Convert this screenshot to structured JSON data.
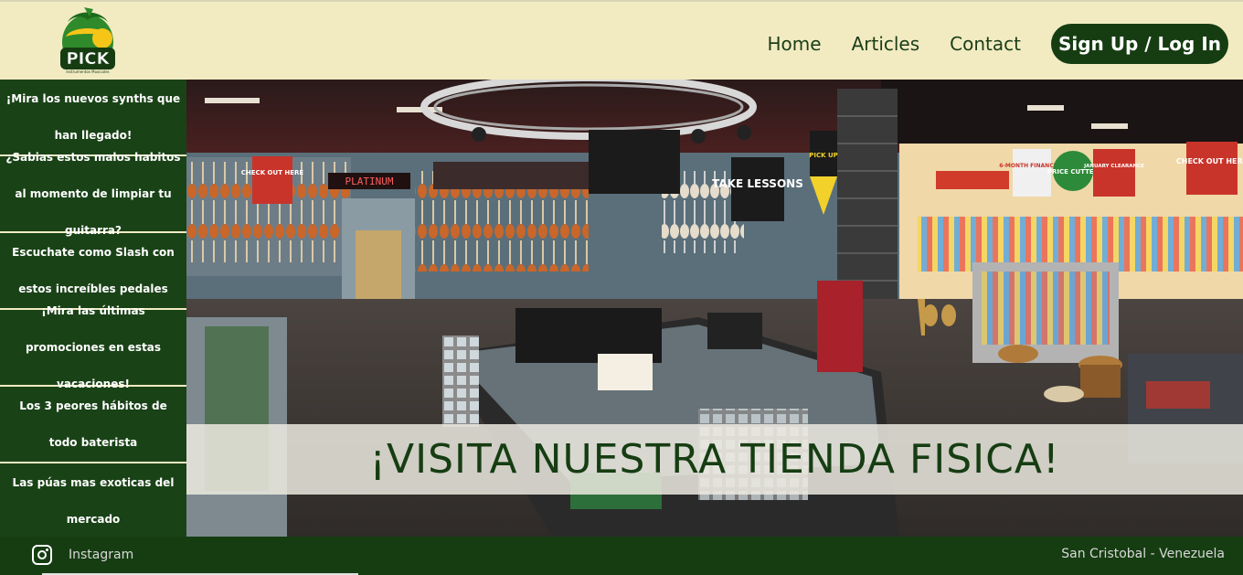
{
  "brand": {
    "logo_text": "PICK",
    "logo_subtext": "Instrumentos Musicales"
  },
  "nav": {
    "home": "Home",
    "articles": "Articles",
    "contact": "Contact",
    "signup": "Sign Up / Log In"
  },
  "sidebar": {
    "items": [
      {
        "label": "¡Mira los nuevos synths que han llegado!"
      },
      {
        "label": "¿Sabias estos malos habitos al momento de limpiar tu guitarra?"
      },
      {
        "label": "Escuchate como Slash con estos increíbles pedales"
      },
      {
        "label": "¡Mira las últimas promociones en estas vacaciones!"
      },
      {
        "label": "Los 3 peores hábitos de todo baterista"
      },
      {
        "label": "Las púas mas exoticas del mercado"
      }
    ]
  },
  "hero": {
    "banner": "¡VISITA NUESTRA TIENDA FISICA!",
    "signs": {
      "platinum": "PLATINUM",
      "check_out_left": "CHECK OUT HERE",
      "check_out_right": "CHECK OUT HERE",
      "take_lessons": "TAKE LESSONS",
      "pick_up": "PICK UP",
      "financing": "6-MONTH FINANCING",
      "price_cutter": "PRICE CUTTER",
      "january": "JANUARY CLEARANCE"
    }
  },
  "footer": {
    "instagram": "Instagram",
    "location": "San Cristobal - Venezuela"
  },
  "colors": {
    "header_bg": "#f2ebc2",
    "primary_green": "#163d12",
    "sidebar_green": "#1a4217"
  }
}
